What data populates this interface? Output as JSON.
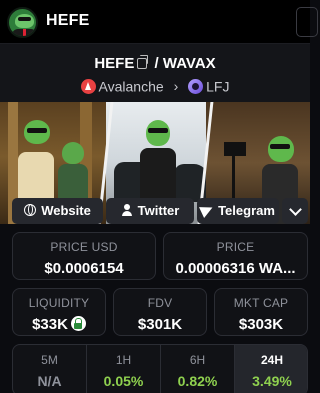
{
  "header": {
    "brand": "HEFE"
  },
  "pair": {
    "base": "HEFE",
    "slash": "/",
    "quote": "WAVAX",
    "chain": "Avalanche",
    "dex": "LFJ"
  },
  "social": {
    "website": "Website",
    "twitter": "Twitter",
    "telegram": "Telegram"
  },
  "stats": {
    "price_usd_label": "PRICE USD",
    "price_usd": "$0.0006154",
    "price_label": "PRICE",
    "price": "0.00006316 WA...",
    "liquidity_label": "LIQUIDITY",
    "liquidity": "$33K",
    "fdv_label": "FDV",
    "fdv": "$301K",
    "mktcap_label": "MKT CAP",
    "mktcap": "$303K"
  },
  "timeframes": [
    {
      "label": "5M",
      "value": "N/A",
      "color": "#8f929b"
    },
    {
      "label": "1H",
      "value": "0.05%",
      "color": "#8fd14f"
    },
    {
      "label": "6H",
      "value": "0.82%",
      "color": "#8fd14f"
    },
    {
      "label": "24H",
      "value": "3.49%",
      "color": "#8fd14f"
    }
  ],
  "colors": {
    "positive": "#8fd14f",
    "avalanche": "#e84142",
    "background": "#0b0c10"
  }
}
